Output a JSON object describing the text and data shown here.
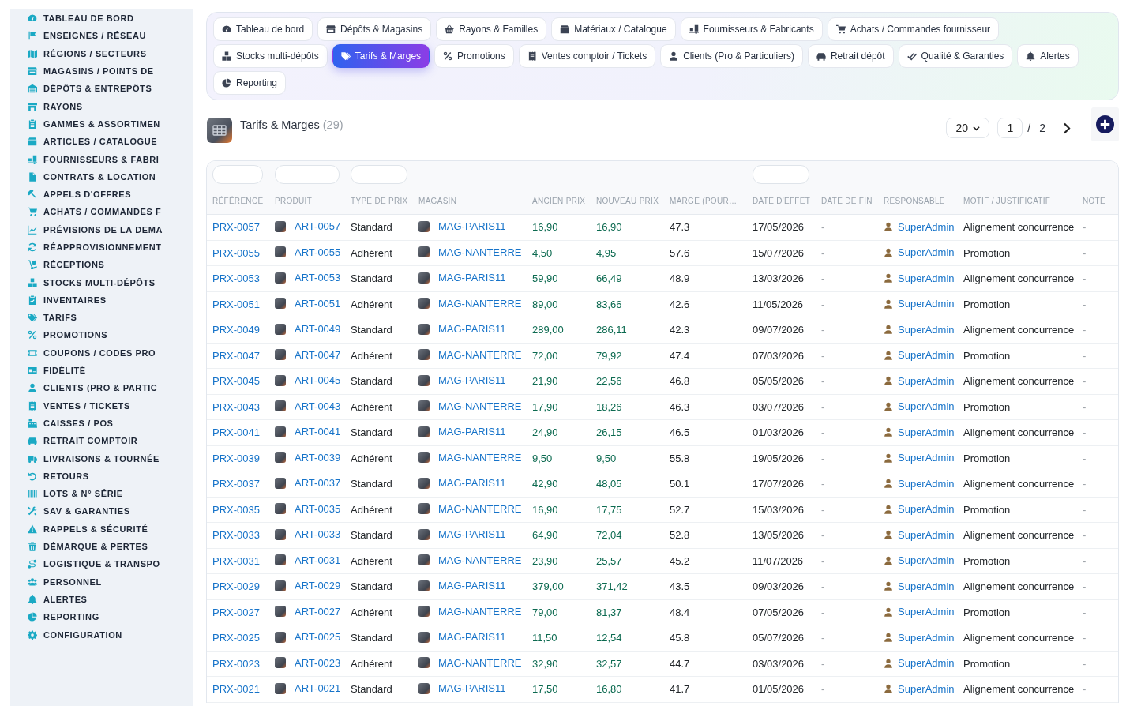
{
  "sidebar": {
    "items": [
      {
        "label": "TABLEAU DE BORD",
        "selected": false
      },
      {
        "label": "ENSEIGNES / RÉSEAU",
        "selected": false
      },
      {
        "label": "RÉGIONS / SECTEURS",
        "selected": false
      },
      {
        "label": "MAGASINS / POINTS DE",
        "selected": false
      },
      {
        "label": "DÉPÔTS & ENTREPÔTS",
        "selected": false
      },
      {
        "label": "RAYONS",
        "selected": false
      },
      {
        "label": "GAMMES & ASSORTIMEN",
        "selected": false
      },
      {
        "label": "ARTICLES / CATALOGUE",
        "selected": false
      },
      {
        "label": "FOURNISSEURS & FABRI",
        "selected": false
      },
      {
        "label": "CONTRATS & LOCATION",
        "selected": false
      },
      {
        "label": "APPELS D'OFFRES",
        "selected": false
      },
      {
        "label": "ACHATS / COMMANDES F",
        "selected": false
      },
      {
        "label": "PRÉVISIONS DE LA DEMA",
        "selected": false
      },
      {
        "label": "RÉAPPROVISIONNEMENT",
        "selected": false
      },
      {
        "label": "RÉCEPTIONS",
        "selected": false
      },
      {
        "label": "STOCKS MULTI-DÉPÔTS",
        "selected": false
      },
      {
        "label": "INVENTAIRES",
        "selected": false
      },
      {
        "label": "TARIFS",
        "selected": false
      },
      {
        "label": "PROMOTIONS",
        "selected": false
      },
      {
        "label": "COUPONS / CODES PRO",
        "selected": false
      },
      {
        "label": "FIDÉLITÉ",
        "selected": false
      },
      {
        "label": "CLIENTS (PRO & PARTIC",
        "selected": false
      },
      {
        "label": "VENTES / TICKETS",
        "selected": false
      },
      {
        "label": "CAISSES / POS",
        "selected": false
      },
      {
        "label": "RETRAIT COMPTOIR",
        "selected": false
      },
      {
        "label": "LIVRAISONS & TOURNÉE",
        "selected": false
      },
      {
        "label": "RETOURS",
        "selected": false
      },
      {
        "label": "LOTS & N° SÉRIE",
        "selected": false
      },
      {
        "label": "SAV & GARANTIES",
        "selected": false
      },
      {
        "label": "RAPPELS & SÉCURITÉ",
        "selected": false
      },
      {
        "label": "DÉMARQUE & PERTES",
        "selected": false
      },
      {
        "label": "LOGISTIQUE & TRANSPO",
        "selected": false
      },
      {
        "label": "PERSONNEL",
        "selected": false
      },
      {
        "label": "ALERTES",
        "selected": false
      },
      {
        "label": "REPORTING",
        "selected": false
      },
      {
        "label": "CONFIGURATION",
        "selected": false
      }
    ]
  },
  "tabs": [
    {
      "label": "Tableau de bord",
      "selected": false
    },
    {
      "label": "Dépôts & Magasins",
      "selected": false
    },
    {
      "label": "Rayons & Familles",
      "selected": false
    },
    {
      "label": "Matériaux / Catalogue",
      "selected": false
    },
    {
      "label": "Fournisseurs & Fabricants",
      "selected": false
    },
    {
      "label": "Achats / Commandes fournisseur",
      "selected": false
    },
    {
      "label": "Stocks multi-dépôts",
      "selected": false
    },
    {
      "label": "Tarifs & Marges",
      "selected": true
    },
    {
      "label": "Promotions",
      "selected": false
    },
    {
      "label": "Ventes comptoir / Tickets",
      "selected": false
    },
    {
      "label": "Clients (Pro & Particuliers)",
      "selected": false
    },
    {
      "label": "Retrait dépôt",
      "selected": false
    },
    {
      "label": "Qualité & Garanties",
      "selected": false
    },
    {
      "label": "Alertes",
      "selected": false
    },
    {
      "label": "Reporting",
      "selected": false
    }
  ],
  "header": {
    "title": "Tarifs & Marges",
    "count": "(29)"
  },
  "pagination": {
    "page_size": "20",
    "page": "1",
    "separator": "/",
    "total_pages": "2"
  },
  "table": {
    "columns": [
      {
        "label": "RÉFÉRENCE",
        "filter": true,
        "kind": "link"
      },
      {
        "label": "PRODUIT",
        "filter": true,
        "kind": "thumb_link"
      },
      {
        "label": "TYPE DE PRIX",
        "filter": true,
        "kind": "text"
      },
      {
        "label": "MAGASIN",
        "filter": false,
        "kind": "thumb_link"
      },
      {
        "label": "ANCIEN PRIX",
        "filter": false,
        "kind": "money"
      },
      {
        "label": "NOUVEAU PRIX",
        "filter": false,
        "kind": "money"
      },
      {
        "label": "MARGE (POUR…",
        "filter": false,
        "kind": "text"
      },
      {
        "label": "DATE D'EFFET",
        "filter": true,
        "kind": "text"
      },
      {
        "label": "DATE DE FIN",
        "filter": false,
        "kind": "muted"
      },
      {
        "label": "RESPONSABLE",
        "filter": false,
        "kind": "user_link"
      },
      {
        "label": "MOTIF / JUSTIFICATIF",
        "filter": false,
        "kind": "text"
      },
      {
        "label": "NOTE",
        "filter": false,
        "kind": "muted"
      }
    ],
    "rows": [
      {
        "cells": [
          "PRX-0057",
          "ART-0057",
          "Standard",
          "MAG-PARIS11",
          "16,90",
          "16,90",
          "47.3",
          "17/05/2026",
          "-",
          "SuperAdmin",
          "Alignement concurrence",
          "-"
        ]
      },
      {
        "cells": [
          "PRX-0055",
          "ART-0055",
          "Adhérent",
          "MAG-NANTERRE",
          "4,50",
          "4,95",
          "57.6",
          "15/07/2026",
          "-",
          "SuperAdmin",
          "Promotion",
          "-"
        ]
      },
      {
        "cells": [
          "PRX-0053",
          "ART-0053",
          "Standard",
          "MAG-PARIS11",
          "59,90",
          "66,49",
          "48.9",
          "13/03/2026",
          "-",
          "SuperAdmin",
          "Alignement concurrence",
          "-"
        ]
      },
      {
        "cells": [
          "PRX-0051",
          "ART-0051",
          "Adhérent",
          "MAG-NANTERRE",
          "89,00",
          "83,66",
          "42.6",
          "11/05/2026",
          "-",
          "SuperAdmin",
          "Promotion",
          "-"
        ]
      },
      {
        "cells": [
          "PRX-0049",
          "ART-0049",
          "Standard",
          "MAG-PARIS11",
          "289,00",
          "286,11",
          "42.3",
          "09/07/2026",
          "-",
          "SuperAdmin",
          "Alignement concurrence",
          "-"
        ]
      },
      {
        "cells": [
          "PRX-0047",
          "ART-0047",
          "Adhérent",
          "MAG-NANTERRE",
          "72,00",
          "79,92",
          "47.4",
          "07/03/2026",
          "-",
          "SuperAdmin",
          "Promotion",
          "-"
        ]
      },
      {
        "cells": [
          "PRX-0045",
          "ART-0045",
          "Standard",
          "MAG-PARIS11",
          "21,90",
          "22,56",
          "46.8",
          "05/05/2026",
          "-",
          "SuperAdmin",
          "Alignement concurrence",
          "-"
        ]
      },
      {
        "cells": [
          "PRX-0043",
          "ART-0043",
          "Adhérent",
          "MAG-NANTERRE",
          "17,90",
          "18,26",
          "46.3",
          "03/07/2026",
          "-",
          "SuperAdmin",
          "Promotion",
          "-"
        ]
      },
      {
        "cells": [
          "PRX-0041",
          "ART-0041",
          "Standard",
          "MAG-PARIS11",
          "24,90",
          "26,15",
          "46.5",
          "01/03/2026",
          "-",
          "SuperAdmin",
          "Alignement concurrence",
          "-"
        ]
      },
      {
        "cells": [
          "PRX-0039",
          "ART-0039",
          "Adhérent",
          "MAG-NANTERRE",
          "9,50",
          "9,50",
          "55.8",
          "19/05/2026",
          "-",
          "SuperAdmin",
          "Promotion",
          "-"
        ]
      },
      {
        "cells": [
          "PRX-0037",
          "ART-0037",
          "Standard",
          "MAG-PARIS11",
          "42,90",
          "48,05",
          "50.1",
          "17/07/2026",
          "-",
          "SuperAdmin",
          "Alignement concurrence",
          "-"
        ]
      },
      {
        "cells": [
          "PRX-0035",
          "ART-0035",
          "Adhérent",
          "MAG-NANTERRE",
          "16,90",
          "17,75",
          "52.7",
          "15/03/2026",
          "-",
          "SuperAdmin",
          "Promotion",
          "-"
        ]
      },
      {
        "cells": [
          "PRX-0033",
          "ART-0033",
          "Standard",
          "MAG-PARIS11",
          "64,90",
          "72,04",
          "52.8",
          "13/05/2026",
          "-",
          "SuperAdmin",
          "Alignement concurrence",
          "-"
        ]
      },
      {
        "cells": [
          "PRX-0031",
          "ART-0031",
          "Adhérent",
          "MAG-NANTERRE",
          "23,90",
          "25,57",
          "45.2",
          "11/07/2026",
          "-",
          "SuperAdmin",
          "Promotion",
          "-"
        ]
      },
      {
        "cells": [
          "PRX-0029",
          "ART-0029",
          "Standard",
          "MAG-PARIS11",
          "379,00",
          "371,42",
          "43.5",
          "09/03/2026",
          "-",
          "SuperAdmin",
          "Alignement concurrence",
          "-"
        ]
      },
      {
        "cells": [
          "PRX-0027",
          "ART-0027",
          "Adhérent",
          "MAG-NANTERRE",
          "79,00",
          "81,37",
          "48.4",
          "07/05/2026",
          "-",
          "SuperAdmin",
          "Promotion",
          "-"
        ]
      },
      {
        "cells": [
          "PRX-0025",
          "ART-0025",
          "Standard",
          "MAG-PARIS11",
          "11,50",
          "12,54",
          "45.8",
          "05/07/2026",
          "-",
          "SuperAdmin",
          "Alignement concurrence",
          "-"
        ]
      },
      {
        "cells": [
          "PRX-0023",
          "ART-0023",
          "Adhérent",
          "MAG-NANTERRE",
          "32,90",
          "32,57",
          "44.7",
          "03/03/2026",
          "-",
          "SuperAdmin",
          "Promotion",
          "-"
        ]
      },
      {
        "cells": [
          "PRX-0021",
          "ART-0021",
          "Standard",
          "MAG-PARIS11",
          "17,50",
          "16,80",
          "41.7",
          "01/05/2026",
          "-",
          "SuperAdmin",
          "Alignement concurrence",
          "-"
        ]
      }
    ]
  }
}
